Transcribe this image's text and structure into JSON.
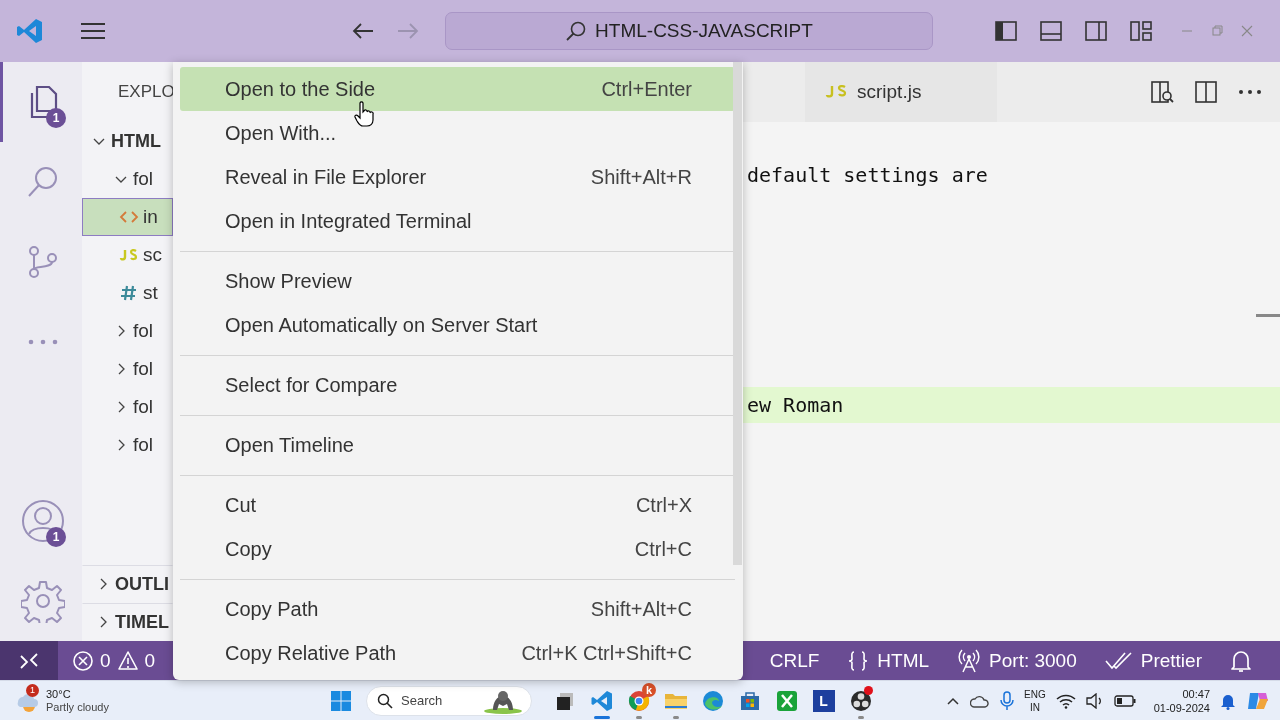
{
  "title_bar": {
    "search": "HTML-CSS-JAVASCRIPT",
    "nav": [
      {
        "kind": "back",
        "disabled": false
      },
      {
        "kind": "forward",
        "disabled": true
      }
    ]
  },
  "activity_bar": {
    "items": [
      {
        "kind": "explorer",
        "selected": true,
        "badge": "1"
      },
      {
        "kind": "search",
        "selected": false
      },
      {
        "kind": "source_control",
        "selected": false
      },
      {
        "kind": "more",
        "selected": false
      }
    ],
    "bottom": [
      {
        "kind": "accounts",
        "badge": "1"
      },
      {
        "kind": "settings"
      }
    ]
  },
  "sidebar": {
    "header": "EXPLO",
    "section": {
      "title": "HTML",
      "expanded": true,
      "children": [
        {
          "label": "fol",
          "kind": "folder",
          "expanded": true,
          "selected": false,
          "children": [
            {
              "label": "in",
              "kind": "html",
              "selected": true
            },
            {
              "label": "sc",
              "kind": "js",
              "selected": false
            },
            {
              "label": "st",
              "kind": "css",
              "selected": false
            }
          ]
        },
        {
          "label": "fol",
          "kind": "folder",
          "expanded": false,
          "selected": false
        },
        {
          "label": "fol",
          "kind": "folder",
          "expanded": false,
          "selected": false
        },
        {
          "label": "fol",
          "kind": "folder",
          "expanded": false,
          "selected": false
        },
        {
          "label": "fol",
          "kind": "folder",
          "expanded": false,
          "selected": false
        }
      ]
    },
    "panels": [
      {
        "title": "OUTLI",
        "expanded": false
      },
      {
        "title": "TIMEL",
        "expanded": false
      }
    ]
  },
  "editor": {
    "tabs": [
      {
        "label": "script.js",
        "kind": "js",
        "selected": false
      }
    ],
    "lines": [
      {
        "text": "default settings are",
        "highlighted": false
      },
      {
        "text": "ew Roman",
        "highlighted": true
      }
    ]
  },
  "context_menu": {
    "items": [
      {
        "kind": "item",
        "label": "Open to the Side",
        "shortcut": "Ctrl+Enter",
        "selected": true
      },
      {
        "kind": "item",
        "label": "Open With...",
        "selected": false
      },
      {
        "kind": "item",
        "label": "Reveal in File Explorer",
        "shortcut": "Shift+Alt+R",
        "selected": false
      },
      {
        "kind": "item",
        "label": "Open in Integrated Terminal",
        "selected": false
      },
      {
        "kind": "separator"
      },
      {
        "kind": "item",
        "label": "Show Preview",
        "selected": false
      },
      {
        "kind": "item",
        "label": "Open Automatically on Server Start",
        "selected": false
      },
      {
        "kind": "separator"
      },
      {
        "kind": "item",
        "label": "Select for Compare",
        "selected": false
      },
      {
        "kind": "separator"
      },
      {
        "kind": "item",
        "label": "Open Timeline",
        "selected": false
      },
      {
        "kind": "separator"
      },
      {
        "kind": "item",
        "label": "Cut",
        "shortcut": "Ctrl+X",
        "selected": false
      },
      {
        "kind": "item",
        "label": "Copy",
        "shortcut": "Ctrl+C",
        "selected": false
      },
      {
        "kind": "separator"
      },
      {
        "kind": "item",
        "label": "Copy Path",
        "shortcut": "Shift+Alt+C",
        "selected": false
      },
      {
        "kind": "item",
        "label": "Copy Relative Path",
        "shortcut": "Ctrl+K Ctrl+Shift+C",
        "selected": false
      }
    ]
  },
  "status_bar": {
    "errors": "0",
    "warnings": "0",
    "items": [
      {
        "kind": "eol",
        "label": "CRLF"
      },
      {
        "kind": "language",
        "label": "HTML"
      },
      {
        "kind": "port",
        "label": "Port: 3000"
      },
      {
        "kind": "formatter",
        "label": "Prettier"
      },
      {
        "kind": "notifications"
      }
    ]
  },
  "taskbar": {
    "weather": {
      "temperature": "30°C",
      "condition": "Partly cloudy",
      "badge": "1"
    },
    "search": {
      "placeholder": "Search"
    },
    "apps": [
      {
        "kind": "task_view",
        "active": false,
        "running": false
      },
      {
        "kind": "vscode",
        "active": true,
        "running": true
      },
      {
        "kind": "browser",
        "active": false,
        "running": true,
        "badge": "k"
      },
      {
        "kind": "files",
        "active": false,
        "running": true
      },
      {
        "kind": "edge",
        "active": false,
        "running": false
      },
      {
        "kind": "store",
        "active": false,
        "running": false
      },
      {
        "kind": "xbox",
        "active": false,
        "running": false
      },
      {
        "kind": "letter",
        "label": "L",
        "active": false,
        "running": false
      },
      {
        "kind": "recorder",
        "active": false,
        "running": true,
        "alert": true
      }
    ],
    "tray": {
      "language": "ENG",
      "region": "IN",
      "time": "00:47",
      "date": "01-09-2024"
    }
  }
}
